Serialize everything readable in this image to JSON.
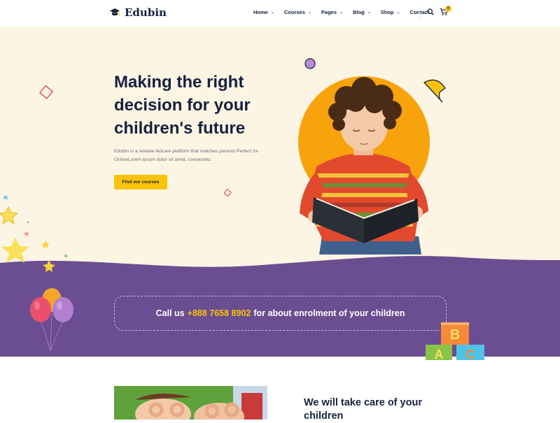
{
  "header": {
    "logo_text": "Edubin",
    "nav": [
      {
        "label": "Home",
        "has_dropdown": true
      },
      {
        "label": "Courses",
        "has_dropdown": true
      },
      {
        "label": "Pages",
        "has_dropdown": true
      },
      {
        "label": "Blog",
        "has_dropdown": true
      },
      {
        "label": "Shop",
        "has_dropdown": true
      },
      {
        "label": "Contact",
        "has_dropdown": false
      }
    ],
    "cart_count": "0",
    "icons": [
      "graduation-cap-icon",
      "search-icon",
      "cart-icon"
    ]
  },
  "hero": {
    "title": "Making the right decision for your children's future",
    "description": "Edubin is a reliable kidcare platform that matches parents Perfect for OnlineLorem ipsum dolor sit amet, consectetu",
    "button_label": "Find our courses"
  },
  "callus": {
    "prefix": "Call us",
    "phone": "+888 7658 8902",
    "suffix": "for about enrolment of your children"
  },
  "blocks": [
    "B",
    "A",
    "C"
  ],
  "section2": {
    "title": "We will take care of your children"
  },
  "colors": {
    "primary_dark": "#16213e",
    "accent_yellow": "#f9c20b",
    "purple": "#6b4e91",
    "hero_bg": "#fdf5e4"
  }
}
